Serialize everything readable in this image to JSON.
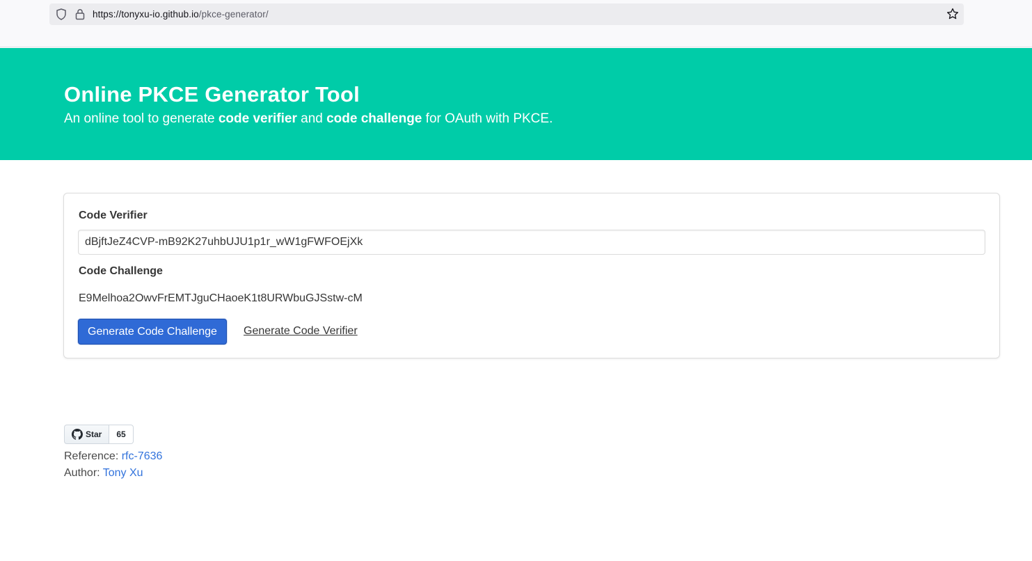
{
  "browser": {
    "url_host": "https://tonyxu-io.github.io",
    "url_path": "/pkce-generator/"
  },
  "hero": {
    "title": "Online PKCE Generator Tool",
    "subtitle_pre": "An online tool to generate ",
    "subtitle_b1": "code verifier",
    "subtitle_mid": " and ",
    "subtitle_b2": "code challenge",
    "subtitle_post": " for OAuth with PKCE."
  },
  "form": {
    "verifier_label": "Code Verifier",
    "verifier_value": "dBjftJeZ4CVP-mB92K27uhbUJU1p1r_wW1gFWFOEjXk",
    "challenge_label": "Code Challenge",
    "challenge_value": "E9Melhoa2OwvFrEMTJguCHaoeK1t8URWbuGJSstw-cM",
    "generate_challenge_label": "Generate Code Challenge",
    "generate_verifier_label": "Generate Code Verifier"
  },
  "footer": {
    "github_star_label": "Star",
    "github_star_count": "65",
    "reference_label": "Reference: ",
    "reference_link": "rfc-7636",
    "author_label": "Author: ",
    "author_link": "Tony Xu"
  },
  "colors": {
    "hero_bg": "#00cca8",
    "primary_button": "#2f6ad6",
    "link": "#3273dc"
  }
}
